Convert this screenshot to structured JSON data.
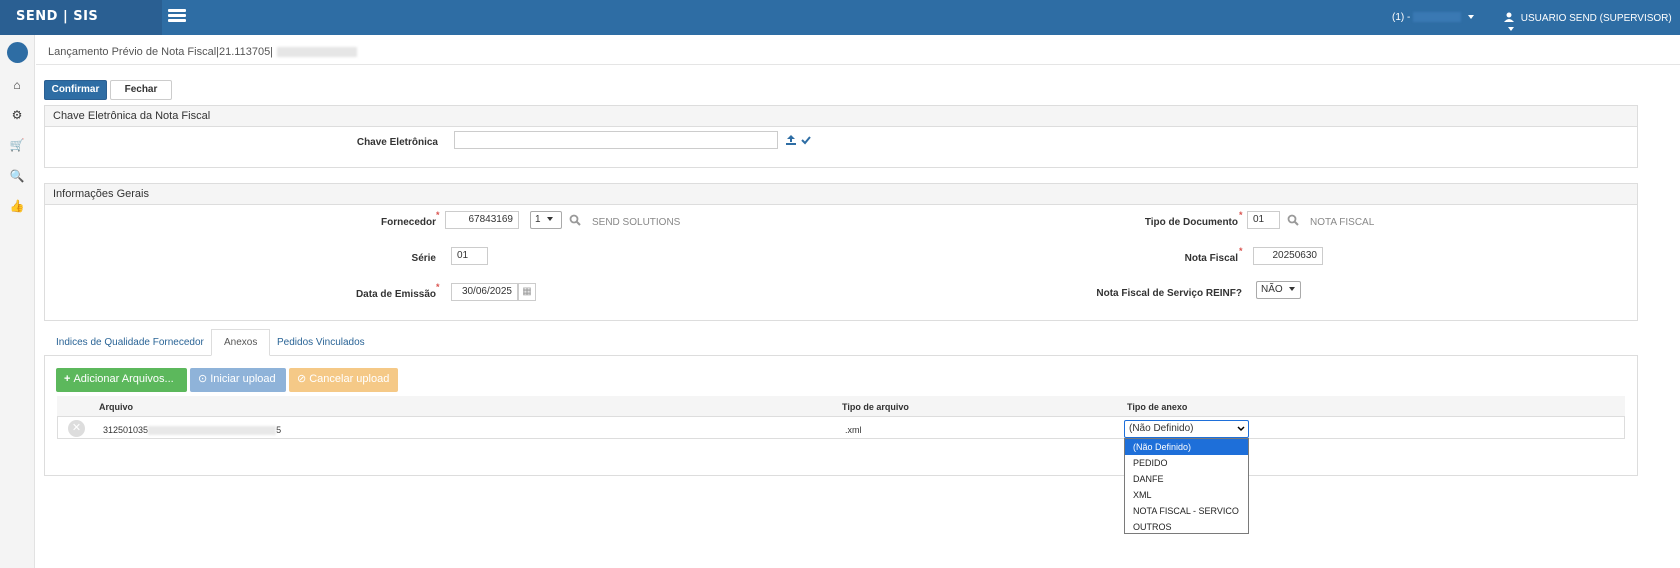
{
  "app": {
    "brand": "SEND | SIS"
  },
  "header": {
    "company_select": "(1) -",
    "user": "USUARIO SEND (SUPERVISOR)"
  },
  "page": {
    "title": "Lançamento Prévio de Nota Fiscal|21.113705|"
  },
  "toolbar": {
    "confirm_label": "Confirmar",
    "close_label": "Fechar"
  },
  "chave_panel": {
    "title": "Chave Eletrônica da Nota Fiscal",
    "label": "Chave Eletrônica",
    "value": ""
  },
  "info_panel": {
    "title": "Informações Gerais",
    "fornecedor": {
      "label": "Fornecedor",
      "code": "67843169",
      "seq": "1",
      "name": "SEND SOLUTIONS"
    },
    "serie": {
      "label": "Série",
      "value": "01"
    },
    "data_emissao": {
      "label": "Data de Emissão",
      "value": "30/06/2025"
    },
    "tipo_documento": {
      "label": "Tipo de Documento",
      "code": "01",
      "name": "NOTA FISCAL"
    },
    "nota_fiscal": {
      "label": "Nota Fiscal",
      "value": "20250630"
    },
    "reinf": {
      "label": "Nota Fiscal de Serviço REINF?",
      "value": "NÃO"
    }
  },
  "tabs": [
    {
      "label": "Indices de Qualidade Fornecedor",
      "active": false
    },
    {
      "label": "Anexos",
      "active": true
    },
    {
      "label": "Pedidos Vinculados",
      "active": false
    }
  ],
  "upload": {
    "add_label": "Adicionar Arquivos...",
    "start_label": "Iniciar upload",
    "cancel_label": "Cancelar upload",
    "colors": {
      "add": "#5cb85c",
      "start": "#8fb3d9",
      "cancel": "#f5c987"
    }
  },
  "table": {
    "columns": [
      "Arquivo",
      "Tipo de arquivo",
      "Tipo de anexo"
    ],
    "rows": [
      {
        "file_start": "312501035",
        "file_end": "5",
        "type": ".xml",
        "attachment_type": "(Não Definido)"
      }
    ]
  },
  "attachment_options": [
    "(Não Definido)",
    "PEDIDO",
    "DANFE",
    "XML",
    "NOTA FISCAL - SERVICO",
    "OUTROS"
  ]
}
